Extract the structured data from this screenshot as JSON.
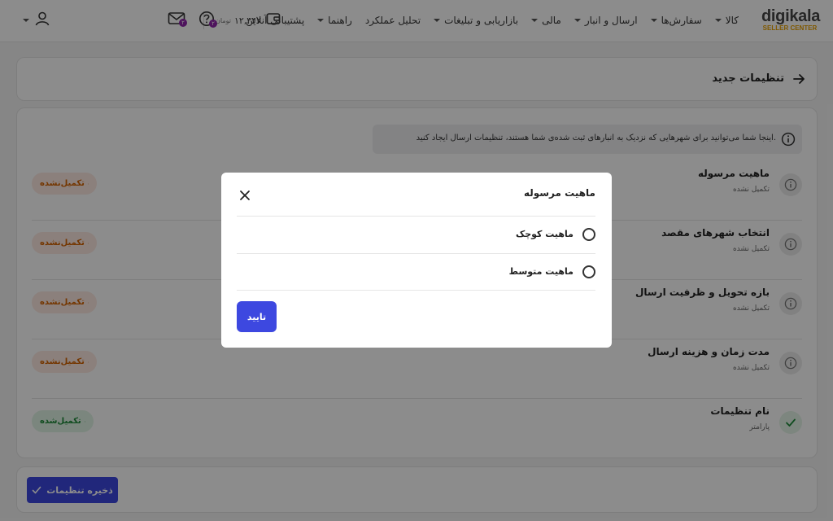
{
  "header": {
    "logo": {
      "main": "digikala",
      "sub": "SELLER CENTER"
    },
    "nav": [
      {
        "label": "کالا",
        "caret": true
      },
      {
        "label": "سفارش‌ها",
        "caret": true
      },
      {
        "label": "ارسال و انبار",
        "caret": true
      },
      {
        "label": "مالی",
        "caret": true
      },
      {
        "label": "بازاریابی و تبلیغات",
        "caret": true
      },
      {
        "label": "تحلیل عملکرد",
        "caret": false
      },
      {
        "label": "راهنما",
        "caret": true
      },
      {
        "label": "پشتیبانی آنلاین",
        "caret": false
      }
    ],
    "wallet": {
      "amount": "۱۲,۳۴۲",
      "unit": "تومان"
    },
    "messages_badge": "۲",
    "help_badge": "۲"
  },
  "page": {
    "title": "تنظیمات جدید",
    "info": "اینجا شما می‌توانید برای شهرهایی که نزدیک به انبارهای ثبت شده‌ی شما هستند، تنظیمات ارسال ایجاد کنید.",
    "steps": [
      {
        "title": "ماهیت مرسوله",
        "subtitle": "تکمیل نشده",
        "status": "تکمیل‌نشده",
        "done": false
      },
      {
        "title": "انتخاب شهرهای مقصد",
        "subtitle": "تکمیل نشده",
        "status": "تکمیل‌نشده",
        "done": false
      },
      {
        "title": "بازه تحویل و ظرفیت ارسال",
        "subtitle": "تکمیل نشده",
        "status": "تکمیل‌نشده",
        "done": false
      },
      {
        "title": "مدت زمان و هزینه ارسال",
        "subtitle": "تکمیل نشده",
        "status": "تکمیل‌نشده",
        "done": false
      },
      {
        "title": "نام تنظیمات",
        "subtitle": "پارامتر",
        "status": "تکمیل‌شده",
        "done": true
      }
    ],
    "save_label": "ذخیره تنظیمات"
  },
  "modal": {
    "title": "ماهیت مرسوله",
    "options": [
      "ماهیت کوچک",
      "ماهیت متوسط"
    ],
    "confirm_label": "تایید"
  },
  "colors": {
    "primary": "#3d48e0",
    "warn_text": "#d46300",
    "warn_bg": "#fde9e2",
    "done_text": "#1e8a3a",
    "done_bg": "#e1f5e6",
    "badge": "#8e24aa",
    "logo_sub": "#e8a100"
  }
}
